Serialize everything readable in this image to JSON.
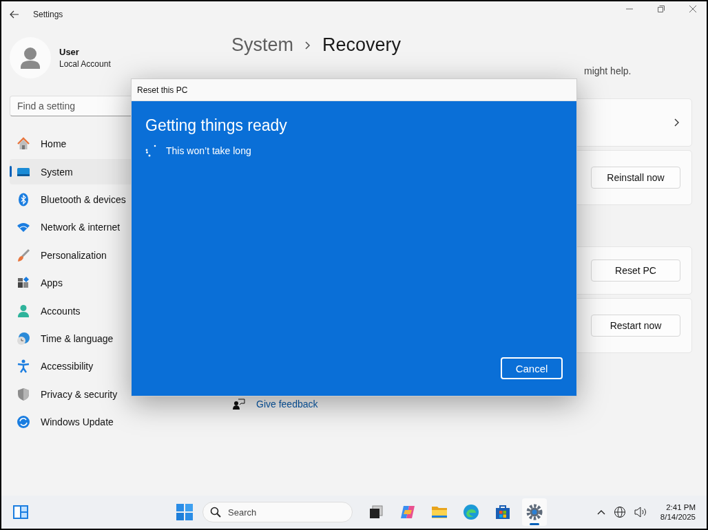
{
  "window": {
    "title": "Settings"
  },
  "user": {
    "name": "User",
    "account": "Local Account"
  },
  "search": {
    "placeholder": "Find a setting"
  },
  "nav": [
    {
      "label": "Home",
      "kind": "home",
      "selected": false
    },
    {
      "label": "System",
      "kind": "system",
      "selected": true
    },
    {
      "label": "Bluetooth & devices",
      "kind": "bluetooth",
      "selected": false
    },
    {
      "label": "Network & internet",
      "kind": "network",
      "selected": false
    },
    {
      "label": "Personalization",
      "kind": "brush",
      "selected": false
    },
    {
      "label": "Apps",
      "kind": "apps",
      "selected": false
    },
    {
      "label": "Accounts",
      "kind": "accounts",
      "selected": false
    },
    {
      "label": "Time & language",
      "kind": "time",
      "selected": false
    },
    {
      "label": "Accessibility",
      "kind": "accessibility",
      "selected": false
    },
    {
      "label": "Privacy & security",
      "kind": "privacy",
      "selected": false
    },
    {
      "label": "Windows Update",
      "kind": "update",
      "selected": false
    }
  ],
  "breadcrumb": {
    "parent": "System",
    "current": "Recovery"
  },
  "description": "might help.",
  "sections": [
    [
      {
        "kind": "chevron"
      },
      {
        "kind": "button",
        "button": "Reinstall now"
      }
    ],
    [
      {
        "kind": "button",
        "button": "Reset PC"
      },
      {
        "kind": "button",
        "button": "Restart now"
      }
    ]
  ],
  "links": [
    {
      "label": "Give feedback"
    }
  ],
  "dialog": {
    "title": "Reset this PC",
    "heading": "Getting things ready",
    "status": "This won’t take long",
    "button": "Cancel"
  },
  "taskbar": {
    "search_placeholder": "Search",
    "time": "2:41 PM",
    "date": "8/14/2025",
    "apps": [
      {
        "kind": "taskview",
        "active": false
      },
      {
        "kind": "copilot",
        "active": false
      },
      {
        "kind": "folder",
        "active": false
      },
      {
        "kind": "edge",
        "active": false
      },
      {
        "kind": "store",
        "active": false
      },
      {
        "kind": "settings",
        "active": true
      }
    ]
  }
}
